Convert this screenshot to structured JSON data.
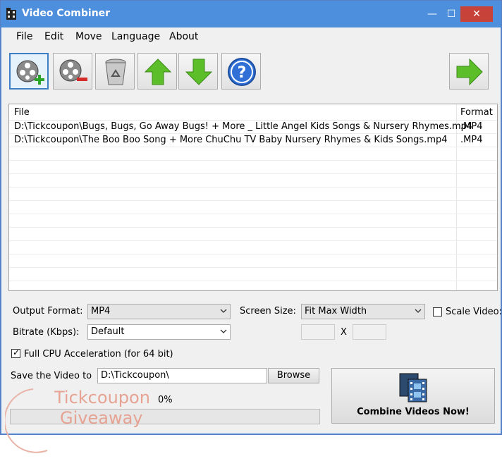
{
  "window": {
    "title": "Video Combiner",
    "minimize_label": "—",
    "maximize_label": "☐",
    "close_label": "✕"
  },
  "menu": [
    "File",
    "Edit",
    "Move",
    "Language",
    "About"
  ],
  "toolbar": {
    "buttons": [
      "add-video",
      "remove-video",
      "clear-list",
      "move-up",
      "move-down",
      "help",
      "next"
    ]
  },
  "file_list": {
    "columns": {
      "file": "File",
      "format": "Format"
    },
    "rows": [
      {
        "file": "D:\\Tickcoupon\\Bugs, Bugs, Go Away Bugs! + More _ Little Angel Kids Songs & Nursery Rhymes.mp4",
        "format": ".MP4"
      },
      {
        "file": "D:\\Tickcoupon\\The Boo Boo Song + More ChuChu TV Baby Nursery Rhymes & Kids Songs.mp4",
        "format": ".MP4"
      }
    ]
  },
  "settings": {
    "output_format_label": "Output Format:",
    "output_format_value": "MP4",
    "bitrate_label": "Bitrate (Kbps):",
    "bitrate_value": "Default",
    "screen_size_label": "Screen Size:",
    "screen_size_value": "Fit Max Width",
    "scale_video_label": "Scale Video:",
    "dimension_separator": "X",
    "cpu_acceleration_label": "Full CPU Acceleration (for 64 bit)",
    "cpu_acceleration_checked": true
  },
  "save": {
    "label": "Save the Video to",
    "path": "D:\\Tickcoupon\\",
    "browse_label": "Browse"
  },
  "progress": {
    "percent_text": "0%",
    "value": 0
  },
  "combine_button_label": "Combine Videos Now!",
  "watermark": {
    "line1": "Tickcoupon",
    "line2": "Giveaway"
  },
  "colors": {
    "titlebar": "#4e8fdd",
    "close": "#c7433a",
    "accent": "#3d7fc4"
  }
}
